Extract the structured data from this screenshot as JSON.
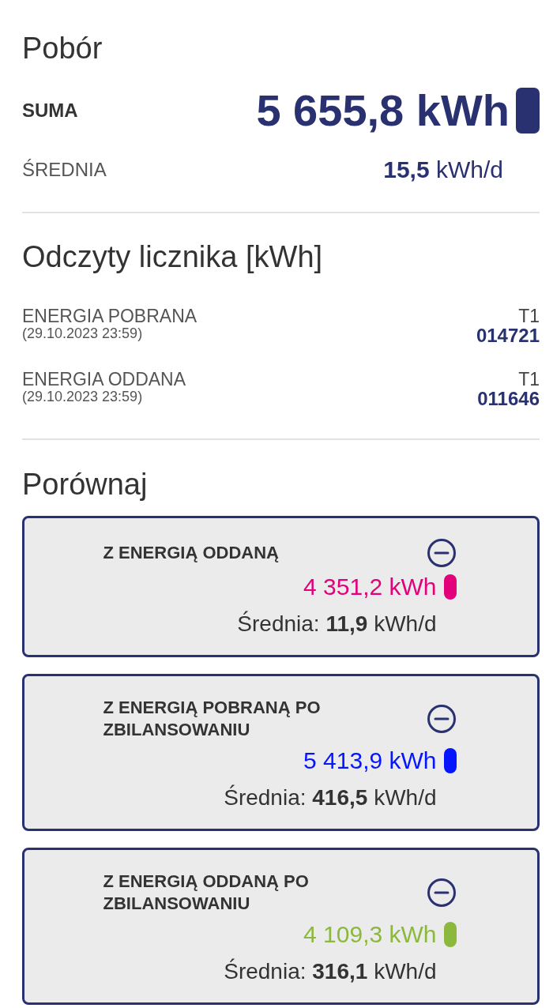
{
  "consumption": {
    "title": "Pobór",
    "total": {
      "label": "SUMA",
      "value": "5 655,8 kWh"
    },
    "average": {
      "label": "ŚREDNIA",
      "value": "**15,5** kWh/d"
    }
  },
  "meter_readings": {
    "title": "Odczyty licznika [kWh]",
    "rows": [
      {
        "label": "ENERGIA POBRANA",
        "timestamp": "(29.10.2023 23:59)",
        "tariff": "T1",
        "value": "014721"
      },
      {
        "label": "ENERGIA ODDANA",
        "timestamp": "(29.10.2023 23:59)",
        "tariff": "T1",
        "value": "011646"
      }
    ]
  },
  "compare": {
    "title": "Porównaj",
    "items": [
      {
        "title": "Z ENERGIĄ ODDANĄ",
        "value": "4 351,2 kWh",
        "color": "#e3007b",
        "average": "Średnia: **11,9** kWh/d"
      },
      {
        "title": "Z ENERGIĄ POBRANĄ PO ZBILANSOWANIU",
        "value": "5 413,9 kWh",
        "color": "#0515ff",
        "average": "Średnia: **416,5** kWh/d"
      },
      {
        "title": "Z ENERGIĄ ODDANĄ PO ZBILANSOWANIU",
        "value": "4 109,3 kWh",
        "color": "#8cb83e",
        "average": "Średnia: **316,1** kWh/d"
      }
    ]
  }
}
